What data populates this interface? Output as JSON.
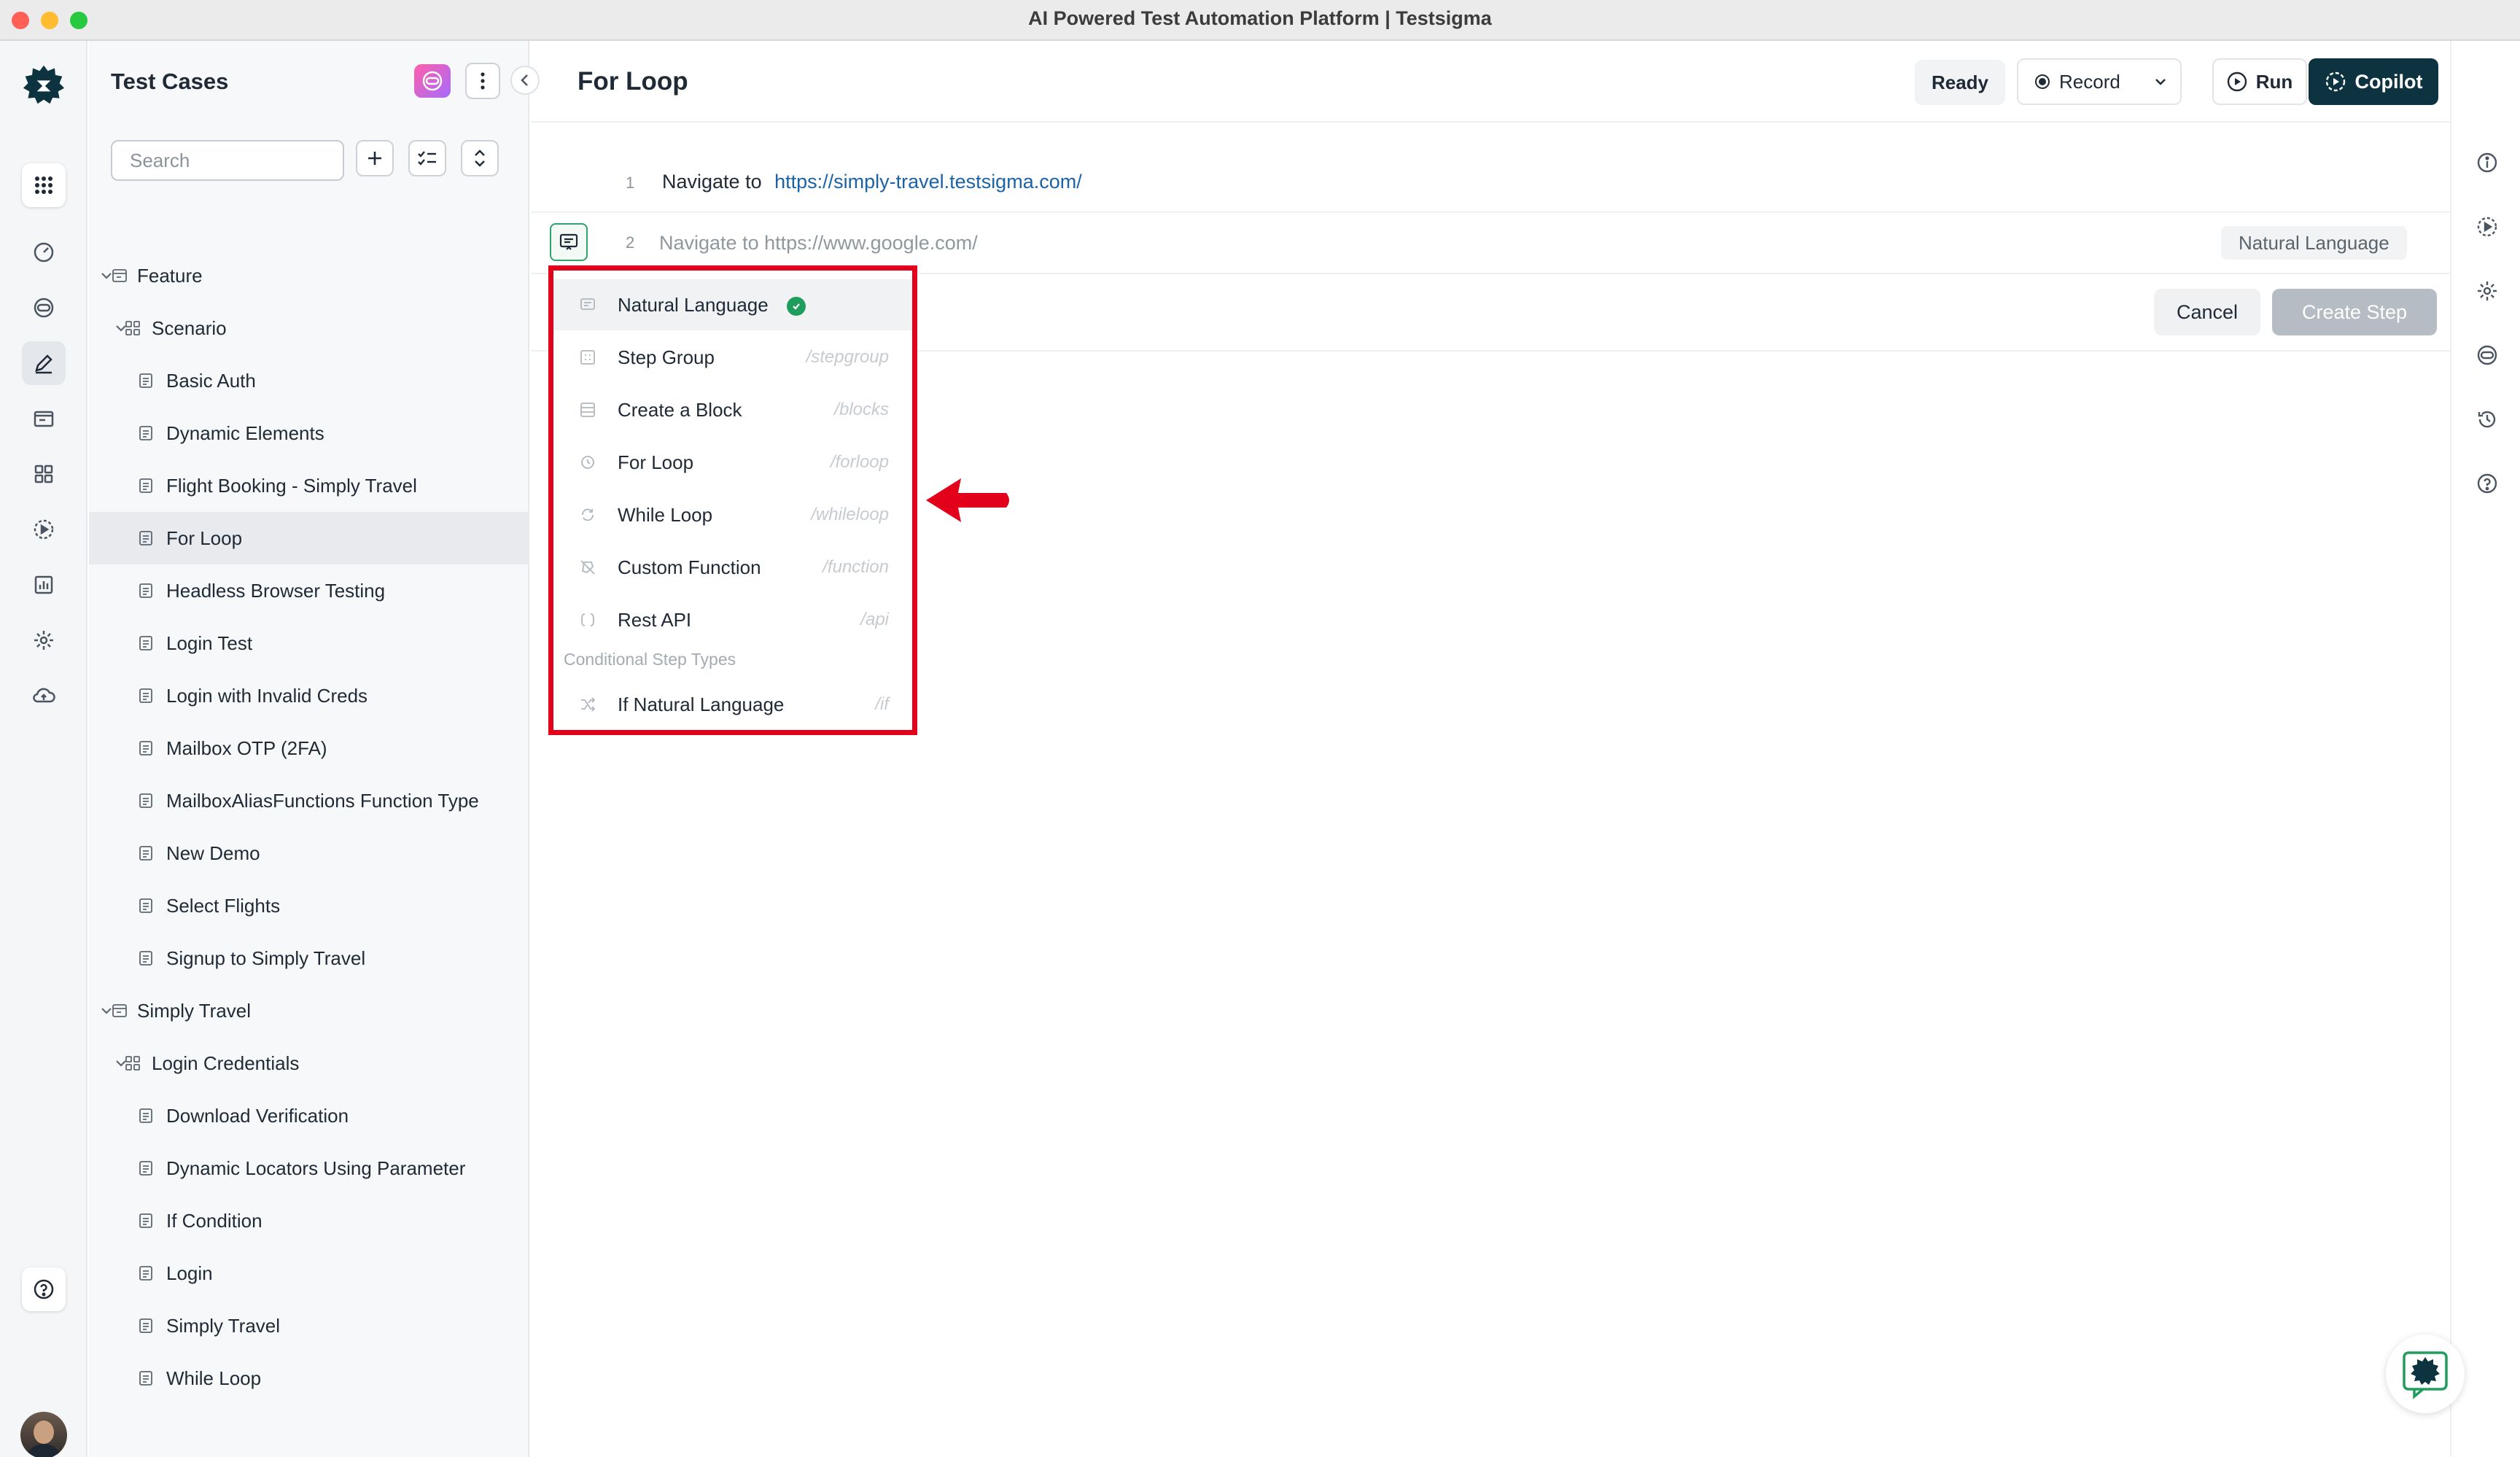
{
  "window": {
    "title": "AI Powered Test Automation Platform | Testsigma"
  },
  "rail": {
    "items": [
      {
        "icon": "apps-grid-icon"
      },
      {
        "icon": "dashboard-icon"
      },
      {
        "icon": "copilot-eye-icon"
      },
      {
        "icon": "edit-pencil-icon"
      },
      {
        "icon": "folder-icon"
      },
      {
        "icon": "modules-icon"
      },
      {
        "icon": "run-circle-icon"
      },
      {
        "icon": "reports-icon"
      },
      {
        "icon": "settings-gear-icon"
      },
      {
        "icon": "cloud-icon"
      }
    ],
    "help_icon": "help-circle-icon"
  },
  "tree": {
    "title": "Test Cases",
    "search_placeholder": "Search",
    "items": [
      {
        "label": "Feature",
        "level": 0,
        "type": "folder",
        "expanded": true
      },
      {
        "label": "Scenario",
        "level": 1,
        "type": "group",
        "expanded": true
      },
      {
        "label": "Basic Auth",
        "level": 2,
        "type": "case"
      },
      {
        "label": "Dynamic Elements",
        "level": 2,
        "type": "case"
      },
      {
        "label": "Flight Booking - Simply Travel",
        "level": 2,
        "type": "case"
      },
      {
        "label": "For Loop",
        "level": 2,
        "type": "case",
        "selected": true
      },
      {
        "label": "Headless Browser Testing",
        "level": 2,
        "type": "case"
      },
      {
        "label": "Login Test",
        "level": 2,
        "type": "case"
      },
      {
        "label": "Login with Invalid Creds",
        "level": 2,
        "type": "case"
      },
      {
        "label": "Mailbox OTP (2FA)",
        "level": 2,
        "type": "case"
      },
      {
        "label": "MailboxAliasFunctions Function Type",
        "level": 2,
        "type": "case"
      },
      {
        "label": "New Demo",
        "level": 2,
        "type": "case"
      },
      {
        "label": "Select Flights",
        "level": 2,
        "type": "case"
      },
      {
        "label": "Signup to Simply Travel",
        "level": 2,
        "type": "case"
      },
      {
        "label": "Simply Travel",
        "level": 0,
        "type": "folder",
        "expanded": true
      },
      {
        "label": "Login Credentials",
        "level": 1,
        "type": "group",
        "expanded": true
      },
      {
        "label": "Download Verification",
        "level": 2,
        "type": "case"
      },
      {
        "label": "Dynamic Locators Using Parameter",
        "level": 2,
        "type": "case"
      },
      {
        "label": "If Condition",
        "level": 2,
        "type": "case"
      },
      {
        "label": "Login",
        "level": 2,
        "type": "case"
      },
      {
        "label": "Simply Travel",
        "level": 2,
        "type": "case"
      },
      {
        "label": "While Loop",
        "level": 2,
        "type": "case"
      }
    ]
  },
  "main": {
    "title": "For Loop",
    "status": "Ready",
    "record_label": "Record",
    "run_label": "Run",
    "copilot_label": "Copilot",
    "steps": [
      {
        "number": "1",
        "action": "Navigate to",
        "link": "https://simply-travel.testsigma.com/"
      }
    ],
    "new_step": {
      "number": "2",
      "placeholder": "Navigate to https://www.google.com/",
      "type_chip": "Natural Language"
    },
    "cancel_label": "Cancel",
    "create_label": "Create Step"
  },
  "step_type_menu": {
    "items": [
      {
        "label": "Natural Language",
        "command": "",
        "icon": "natural-language-icon",
        "selected": true
      },
      {
        "label": "Step Group",
        "command": "/stepgroup",
        "icon": "step-group-icon"
      },
      {
        "label": "Create a Block",
        "command": "/blocks",
        "icon": "block-icon"
      },
      {
        "label": "For Loop",
        "command": "/forloop",
        "icon": "for-loop-icon"
      },
      {
        "label": "While Loop",
        "command": "/whileloop",
        "icon": "while-loop-icon"
      },
      {
        "label": "Custom Function",
        "command": "/function",
        "icon": "custom-function-icon"
      },
      {
        "label": "Rest API",
        "command": "/api",
        "icon": "rest-api-icon"
      }
    ],
    "section_label": "Conditional Step Types",
    "conditional_items": [
      {
        "label": "If Natural Language",
        "command": "/if",
        "icon": "if-condition-icon"
      }
    ]
  },
  "colors": {
    "brand_dark": "#0d3340",
    "annotation_red": "#e3001b",
    "success_green": "#1f9d5c",
    "link_blue": "#1c62a8"
  }
}
